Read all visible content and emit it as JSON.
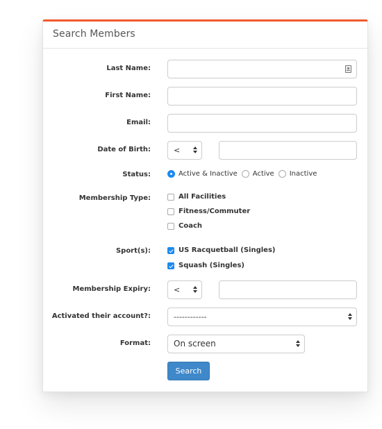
{
  "panel": {
    "title": "Search Members",
    "accent_color": "#f15a2b"
  },
  "fields": {
    "last_name": {
      "label": "Last Name:",
      "value": "",
      "icon": "contact-card-icon"
    },
    "first_name": {
      "label": "First Name:",
      "value": ""
    },
    "email": {
      "label": "Email:",
      "value": ""
    },
    "date_of_birth": {
      "label": "Date of Birth:",
      "operator": "<",
      "value": ""
    },
    "status": {
      "label": "Status:",
      "options": [
        "Active & Inactive",
        "Active",
        "Inactive"
      ],
      "selected": "Active & Inactive"
    },
    "membership_type": {
      "label": "Membership Type:",
      "options": [
        {
          "label": "All Facilities",
          "checked": false
        },
        {
          "label": "Fitness/Commuter",
          "checked": false
        },
        {
          "label": "Coach",
          "checked": false
        }
      ]
    },
    "sports": {
      "label": "Sport(s):",
      "options": [
        {
          "label": "US Racquetball (Singles)",
          "checked": true
        },
        {
          "label": "Squash (Singles)",
          "checked": true
        }
      ]
    },
    "membership_expiry": {
      "label": "Membership Expiry:",
      "operator": "<",
      "value": ""
    },
    "activated_account": {
      "label": "Activated their account?:",
      "selected": "------------"
    },
    "format": {
      "label": "Format:",
      "selected": "On screen"
    }
  },
  "actions": {
    "search_label": "Search",
    "button_color": "#3f88c9"
  }
}
